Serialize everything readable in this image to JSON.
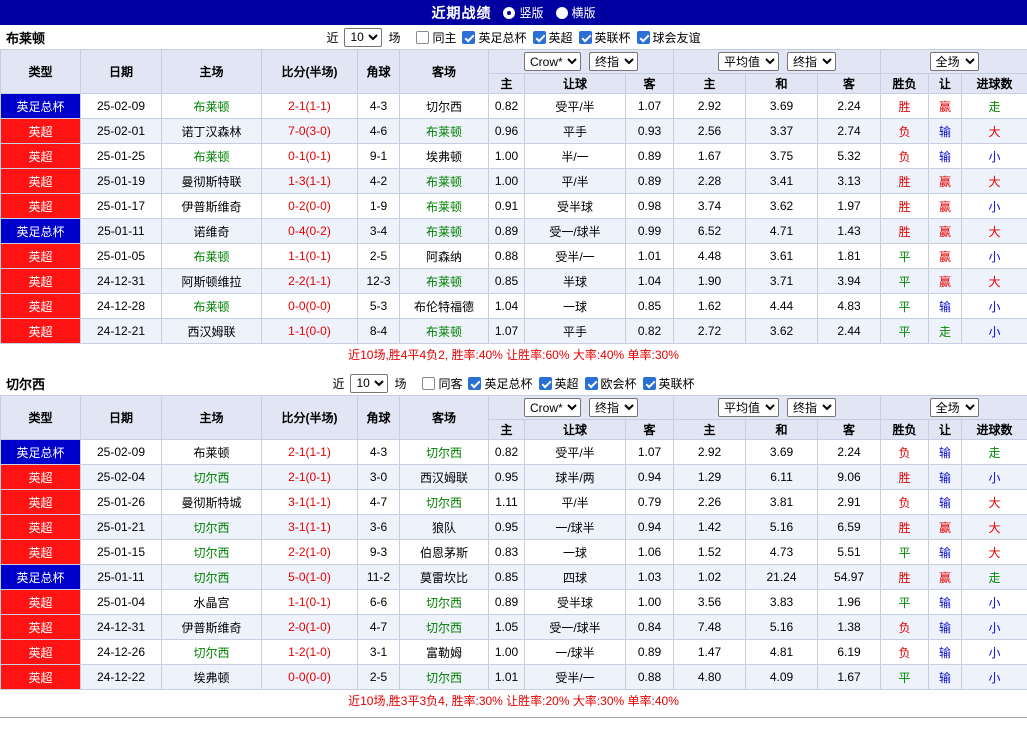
{
  "header": {
    "title": "近期战绩",
    "radio_vertical": "竖版",
    "radio_horizontal": "横版"
  },
  "filters_common": {
    "near_label": "近",
    "near_value": "10",
    "games_label": "场"
  },
  "table_header": {
    "col_type": "类型",
    "col_date": "日期",
    "col_home": "主场",
    "col_score": "比分(半场)",
    "col_corner": "角球",
    "col_away": "客场",
    "dd_crow": "Crow*",
    "dd_final": "终指",
    "dd_avg": "平均值",
    "dd_full": "全场",
    "sub_home": "主",
    "sub_handicap": "让球",
    "sub_away": "客",
    "sub_avg_home": "主",
    "sub_avg_draw": "和",
    "sub_avg_away": "客",
    "sub_result": "胜负",
    "sub_let": "让",
    "sub_goals": "进球数"
  },
  "colors": {
    "titlebar-bg": "#0000a0",
    "head-bg": "#e2e5f3",
    "row-alt": "#eef2fb",
    "grid": "#c6cfe2",
    "epl": "#ff1313",
    "facup": "#0000cc",
    "self-green": "#008000",
    "red": "#e60000",
    "blue": "#0b0bd6",
    "green": "#008800",
    "cb-blue": "#2a6fd6"
  },
  "sections": [
    {
      "team": "布莱顿",
      "same_label": "同主",
      "leagues": [
        "英足总杯",
        "英超",
        "英联杯",
        "球会友谊"
      ],
      "summary": "近10场,胜4平4负2, 胜率:40% 让胜率:60% 大率:40% 单率:30%",
      "rows": [
        {
          "type": "英足总杯",
          "type_color": "blue",
          "date": "25-02-09",
          "home": "布莱顿",
          "home_self": true,
          "score": "2-1(1-1)",
          "corner": "4-3",
          "away": "切尔西",
          "away_self": false,
          "odds_home": "0.82",
          "handicap": "受平/半",
          "odds_away": "1.07",
          "avg_home": "2.92",
          "avg_draw": "3.69",
          "avg_away": "2.24",
          "result": "胜",
          "let": "赢",
          "goals": "走"
        },
        {
          "type": "英超",
          "type_color": "red",
          "date": "25-02-01",
          "home": "诺丁汉森林",
          "home_self": false,
          "score": "7-0(3-0)",
          "corner": "4-6",
          "away": "布莱顿",
          "away_self": true,
          "odds_home": "0.96",
          "handicap": "平手",
          "odds_away": "0.93",
          "avg_home": "2.56",
          "avg_draw": "3.37",
          "avg_away": "2.74",
          "result": "负",
          "let": "输",
          "goals": "大"
        },
        {
          "type": "英超",
          "type_color": "red",
          "date": "25-01-25",
          "home": "布莱顿",
          "home_self": true,
          "score": "0-1(0-1)",
          "corner": "9-1",
          "away": "埃弗顿",
          "away_self": false,
          "odds_home": "1.00",
          "handicap": "半/一",
          "odds_away": "0.89",
          "avg_home": "1.67",
          "avg_draw": "3.75",
          "avg_away": "5.32",
          "result": "负",
          "let": "输",
          "goals": "小"
        },
        {
          "type": "英超",
          "type_color": "red",
          "date": "25-01-19",
          "home": "曼彻斯特联",
          "home_self": false,
          "score": "1-3(1-1)",
          "corner": "4-2",
          "away": "布莱顿",
          "away_self": true,
          "odds_home": "1.00",
          "handicap": "平/半",
          "odds_away": "0.89",
          "avg_home": "2.28",
          "avg_draw": "3.41",
          "avg_away": "3.13",
          "result": "胜",
          "let": "赢",
          "goals": "大"
        },
        {
          "type": "英超",
          "type_color": "red",
          "date": "25-01-17",
          "home": "伊普斯维奇",
          "home_self": false,
          "score": "0-2(0-0)",
          "corner": "1-9",
          "away": "布莱顿",
          "away_self": true,
          "odds_home": "0.91",
          "handicap": "受半球",
          "odds_away": "0.98",
          "avg_home": "3.74",
          "avg_draw": "3.62",
          "avg_away": "1.97",
          "result": "胜",
          "let": "赢",
          "goals": "小"
        },
        {
          "type": "英足总杯",
          "type_color": "blue",
          "date": "25-01-11",
          "home": "诺维奇",
          "home_self": false,
          "score": "0-4(0-2)",
          "corner": "3-4",
          "away": "布莱顿",
          "away_self": true,
          "odds_home": "0.89",
          "handicap": "受一/球半",
          "odds_away": "0.99",
          "avg_home": "6.52",
          "avg_draw": "4.71",
          "avg_away": "1.43",
          "result": "胜",
          "let": "赢",
          "goals": "大"
        },
        {
          "type": "英超",
          "type_color": "red",
          "date": "25-01-05",
          "home": "布莱顿",
          "home_self": true,
          "score": "1-1(0-1)",
          "corner": "2-5",
          "away": "阿森纳",
          "away_self": false,
          "odds_home": "0.88",
          "handicap": "受半/一",
          "odds_away": "1.01",
          "avg_home": "4.48",
          "avg_draw": "3.61",
          "avg_away": "1.81",
          "result": "平",
          "let": "赢",
          "goals": "小"
        },
        {
          "type": "英超",
          "type_color": "red",
          "date": "24-12-31",
          "home": "阿斯顿维拉",
          "home_self": false,
          "score": "2-2(1-1)",
          "corner": "12-3",
          "away": "布莱顿",
          "away_self": true,
          "odds_home": "0.85",
          "handicap": "半球",
          "odds_away": "1.04",
          "avg_home": "1.90",
          "avg_draw": "3.71",
          "avg_away": "3.94",
          "result": "平",
          "let": "赢",
          "goals": "大"
        },
        {
          "type": "英超",
          "type_color": "red",
          "date": "24-12-28",
          "home": "布莱顿",
          "home_self": true,
          "score": "0-0(0-0)",
          "corner": "5-3",
          "away": "布伦特福德",
          "away_self": false,
          "odds_home": "1.04",
          "handicap": "一球",
          "odds_away": "0.85",
          "avg_home": "1.62",
          "avg_draw": "4.44",
          "avg_away": "4.83",
          "result": "平",
          "let": "输",
          "goals": "小"
        },
        {
          "type": "英超",
          "type_color": "red",
          "date": "24-12-21",
          "home": "西汉姆联",
          "home_self": false,
          "score": "1-1(0-0)",
          "corner": "8-4",
          "away": "布莱顿",
          "away_self": true,
          "odds_home": "1.07",
          "handicap": "平手",
          "odds_away": "0.82",
          "avg_home": "2.72",
          "avg_draw": "3.62",
          "avg_away": "2.44",
          "result": "平",
          "let": "走",
          "goals": "小"
        }
      ]
    },
    {
      "team": "切尔西",
      "same_label": "同客",
      "leagues": [
        "英足总杯",
        "英超",
        "欧会杯",
        "英联杯"
      ],
      "summary": "近10场,胜3平3负4, 胜率:30% 让胜率:20% 大率:30% 单率:40%",
      "rows": [
        {
          "type": "英足总杯",
          "type_color": "blue",
          "date": "25-02-09",
          "home": "布莱顿",
          "home_self": false,
          "score": "2-1(1-1)",
          "corner": "4-3",
          "away": "切尔西",
          "away_self": true,
          "odds_home": "0.82",
          "handicap": "受平/半",
          "odds_away": "1.07",
          "avg_home": "2.92",
          "avg_draw": "3.69",
          "avg_away": "2.24",
          "result": "负",
          "let": "输",
          "goals": "走"
        },
        {
          "type": "英超",
          "type_color": "red",
          "date": "25-02-04",
          "home": "切尔西",
          "home_self": true,
          "score": "2-1(0-1)",
          "corner": "3-0",
          "away": "西汉姆联",
          "away_self": false,
          "odds_home": "0.95",
          "handicap": "球半/两",
          "odds_away": "0.94",
          "avg_home": "1.29",
          "avg_draw": "6.11",
          "avg_away": "9.06",
          "result": "胜",
          "let": "输",
          "goals": "小"
        },
        {
          "type": "英超",
          "type_color": "red",
          "date": "25-01-26",
          "home": "曼彻斯特城",
          "home_self": false,
          "score": "3-1(1-1)",
          "corner": "4-7",
          "away": "切尔西",
          "away_self": true,
          "odds_home": "1.11",
          "handicap": "平/半",
          "odds_away": "0.79",
          "avg_home": "2.26",
          "avg_draw": "3.81",
          "avg_away": "2.91",
          "result": "负",
          "let": "输",
          "goals": "大"
        },
        {
          "type": "英超",
          "type_color": "red",
          "date": "25-01-21",
          "home": "切尔西",
          "home_self": true,
          "score": "3-1(1-1)",
          "corner": "3-6",
          "away": "狼队",
          "away_self": false,
          "odds_home": "0.95",
          "handicap": "一/球半",
          "odds_away": "0.94",
          "avg_home": "1.42",
          "avg_draw": "5.16",
          "avg_away": "6.59",
          "result": "胜",
          "let": "赢",
          "goals": "大"
        },
        {
          "type": "英超",
          "type_color": "red",
          "date": "25-01-15",
          "home": "切尔西",
          "home_self": true,
          "score": "2-2(1-0)",
          "corner": "9-3",
          "away": "伯恩茅斯",
          "away_self": false,
          "odds_home": "0.83",
          "handicap": "一球",
          "odds_away": "1.06",
          "avg_home": "1.52",
          "avg_draw": "4.73",
          "avg_away": "5.51",
          "result": "平",
          "let": "输",
          "goals": "大"
        },
        {
          "type": "英足总杯",
          "type_color": "blue",
          "date": "25-01-11",
          "home": "切尔西",
          "home_self": true,
          "score": "5-0(1-0)",
          "corner": "11-2",
          "away": "莫雷坎比",
          "away_self": false,
          "odds_home": "0.85",
          "handicap": "四球",
          "odds_away": "1.03",
          "avg_home": "1.02",
          "avg_draw": "21.24",
          "avg_away": "54.97",
          "result": "胜",
          "let": "赢",
          "goals": "走"
        },
        {
          "type": "英超",
          "type_color": "red",
          "date": "25-01-04",
          "home": "水晶宫",
          "home_self": false,
          "score": "1-1(0-1)",
          "corner": "6-6",
          "away": "切尔西",
          "away_self": true,
          "odds_home": "0.89",
          "handicap": "受半球",
          "odds_away": "1.00",
          "avg_home": "3.56",
          "avg_draw": "3.83",
          "avg_away": "1.96",
          "result": "平",
          "let": "输",
          "goals": "小"
        },
        {
          "type": "英超",
          "type_color": "red",
          "date": "24-12-31",
          "home": "伊普斯维奇",
          "home_self": false,
          "score": "2-0(1-0)",
          "corner": "4-7",
          "away": "切尔西",
          "away_self": true,
          "odds_home": "1.05",
          "handicap": "受一/球半",
          "odds_away": "0.84",
          "avg_home": "7.48",
          "avg_draw": "5.16",
          "avg_away": "1.38",
          "result": "负",
          "let": "输",
          "goals": "小"
        },
        {
          "type": "英超",
          "type_color": "red",
          "date": "24-12-26",
          "home": "切尔西",
          "home_self": true,
          "score": "1-2(1-0)",
          "corner": "3-1",
          "away": "富勒姆",
          "away_self": false,
          "odds_home": "1.00",
          "handicap": "一/球半",
          "odds_away": "0.89",
          "avg_home": "1.47",
          "avg_draw": "4.81",
          "avg_away": "6.19",
          "result": "负",
          "let": "输",
          "goals": "小"
        },
        {
          "type": "英超",
          "type_color": "red",
          "date": "24-12-22",
          "home": "埃弗顿",
          "home_self": false,
          "score": "0-0(0-0)",
          "corner": "2-5",
          "away": "切尔西",
          "away_self": true,
          "odds_home": "1.01",
          "handicap": "受半/一",
          "odds_away": "0.88",
          "avg_home": "4.80",
          "avg_draw": "4.09",
          "avg_away": "1.67",
          "result": "平",
          "let": "输",
          "goals": "小"
        }
      ]
    }
  ]
}
